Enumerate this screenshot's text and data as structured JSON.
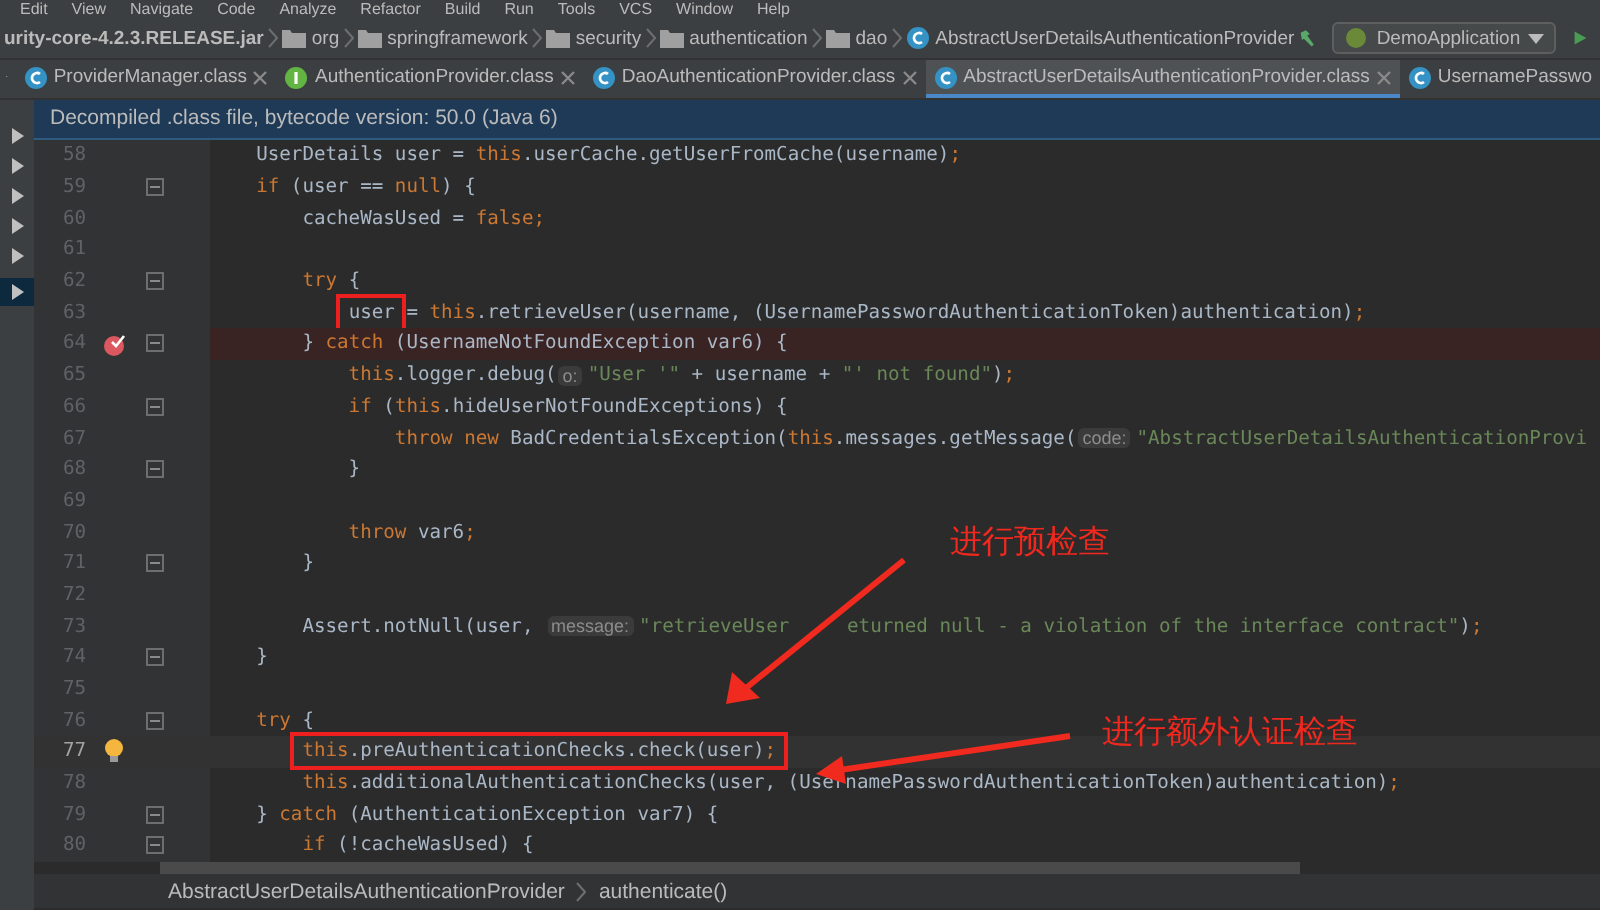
{
  "menu": [
    "Edit",
    "View",
    "Navigate",
    "Code",
    "Analyze",
    "Refactor",
    "Build",
    "Run",
    "Tools",
    "VCS",
    "Window",
    "Help"
  ],
  "breadcrumb": [
    {
      "label": "urity-core-4.2.3.RELEASE.jar",
      "kind": "jar"
    },
    {
      "label": "org",
      "kind": "package"
    },
    {
      "label": "springframework",
      "kind": "package"
    },
    {
      "label": "security",
      "kind": "package"
    },
    {
      "label": "authentication",
      "kind": "package"
    },
    {
      "label": "dao",
      "kind": "package"
    },
    {
      "label": "AbstractUserDetailsAuthenticationProvider",
      "kind": "class"
    }
  ],
  "run_config": "DemoApplication",
  "tabs": [
    {
      "label": "ProviderManager.class",
      "kind": "class",
      "selected": false,
      "closable": true
    },
    {
      "label": "AuthenticationProvider.class",
      "kind": "interface",
      "selected": false,
      "closable": true
    },
    {
      "label": "DaoAuthenticationProvider.class",
      "kind": "class",
      "selected": false,
      "closable": true
    },
    {
      "label": "AbstractUserDetailsAuthenticationProvider.class",
      "kind": "class",
      "selected": true,
      "closable": true
    },
    {
      "label": "UsernamePasswo",
      "kind": "class",
      "selected": false,
      "closable": false
    }
  ],
  "info_bar": "Decompiled .class file, bytecode version: 50.0 (Java 6)",
  "tree_rows": [
    {
      "selected": false
    },
    {
      "selected": false
    },
    {
      "selected": false
    },
    {
      "selected": false
    },
    {
      "selected": false
    },
    {
      "selected": true
    }
  ],
  "lines": [
    {
      "number": "58",
      "fold": false,
      "breakpoint": false,
      "current": false,
      "tokens": [
        {
          "kind": "plain",
          "text": "    UserDetails user = "
        },
        {
          "kind": "kw",
          "text": "this"
        },
        {
          "kind": "plain",
          "text": ".userCache.getUserFromCache(username)"
        },
        {
          "kind": "kw",
          "text": ";"
        }
      ]
    },
    {
      "number": "59",
      "fold": true,
      "breakpoint": false,
      "current": false,
      "tokens": [
        {
          "kind": "kw",
          "text": "    if"
        },
        {
          "kind": "plain",
          "text": " (user == "
        },
        {
          "kind": "kw",
          "text": "null"
        },
        {
          "kind": "plain",
          "text": ") {"
        }
      ]
    },
    {
      "number": "60",
      "fold": false,
      "breakpoint": false,
      "current": false,
      "tokens": [
        {
          "kind": "plain",
          "text": "        cacheWasUsed = "
        },
        {
          "kind": "kw",
          "text": "false;"
        }
      ]
    },
    {
      "number": "61",
      "fold": false,
      "breakpoint": false,
      "current": false
    },
    {
      "number": "62",
      "fold": true,
      "breakpoint": false,
      "current": false,
      "tokens": [
        {
          "kind": "kw",
          "text": "        try"
        },
        {
          "kind": "plain",
          "text": " {"
        }
      ]
    },
    {
      "number": "63",
      "fold": false,
      "breakpoint": false,
      "current": false,
      "tokens": [
        {
          "kind": "boxed",
          "tokens": [
            {
              "kind": "plain",
              "text": "user"
            }
          ]
        },
        {
          "kind": "plain",
          "text": " = "
        },
        {
          "kind": "kw",
          "text": "this"
        },
        {
          "kind": "plain",
          "text": ".retrieveUser(username, (UsernamePasswordAuthenticationToken)authentication)"
        },
        {
          "kind": "kw",
          "text": ";"
        }
      ]
    },
    {
      "number": "64",
      "fold": true,
      "breakpoint": true,
      "current": false,
      "tokens": [
        {
          "kind": "plain",
          "text": "        } "
        },
        {
          "kind": "kw",
          "text": "catch"
        },
        {
          "kind": "plain",
          "text": " (UsernameNotFoundException var6) {"
        }
      ]
    },
    {
      "number": "65",
      "fold": false,
      "breakpoint": false,
      "current": false,
      "tokens": [
        {
          "kind": "kw",
          "text": "            this"
        },
        {
          "kind": "plain",
          "text": ".logger.debug("
        },
        {
          "kind": "hint",
          "text": "o:"
        },
        {
          "kind": "str",
          "text": "\"User '\""
        },
        {
          "kind": "plain",
          "text": " + username + "
        },
        {
          "kind": "str",
          "text": "\"' not found\""
        },
        {
          "kind": "plain",
          "text": ")"
        },
        {
          "kind": "kw",
          "text": ";"
        }
      ]
    },
    {
      "number": "66",
      "fold": true,
      "breakpoint": false,
      "current": false,
      "tokens": [
        {
          "kind": "kw",
          "text": "            if"
        },
        {
          "kind": "plain",
          "text": " ("
        },
        {
          "kind": "kw",
          "text": "this"
        },
        {
          "kind": "plain",
          "text": ".hideUserNotFoundExceptions) {"
        }
      ]
    },
    {
      "number": "67",
      "fold": false,
      "breakpoint": false,
      "current": false,
      "tokens": [
        {
          "kind": "kw",
          "text": "                throw new"
        },
        {
          "kind": "plain",
          "text": " BadCredentialsException("
        },
        {
          "kind": "kw",
          "text": "this"
        },
        {
          "kind": "plain",
          "text": ".messages.getMessage("
        },
        {
          "kind": "hint",
          "text": "code:"
        },
        {
          "kind": "str",
          "text": "\"AbstractUserDetailsAuthenticationProvi"
        }
      ]
    },
    {
      "number": "68",
      "fold": true,
      "breakpoint": false,
      "current": false,
      "tokens": [
        {
          "kind": "plain",
          "text": "            }"
        }
      ]
    },
    {
      "number": "69",
      "fold": false,
      "breakpoint": false,
      "current": false
    },
    {
      "number": "70",
      "fold": false,
      "breakpoint": false,
      "current": false,
      "tokens": [
        {
          "kind": "kw",
          "text": "            throw"
        },
        {
          "kind": "plain",
          "text": " var6"
        },
        {
          "kind": "kw",
          "text": ";"
        }
      ]
    },
    {
      "number": "71",
      "fold": true,
      "breakpoint": false,
      "current": false,
      "tokens": [
        {
          "kind": "plain",
          "text": "        }"
        }
      ]
    },
    {
      "number": "72",
      "fold": false,
      "breakpoint": false,
      "current": false
    },
    {
      "number": "73",
      "fold": false,
      "breakpoint": false,
      "current": false,
      "tokens": [
        {
          "kind": "plain",
          "text": "        Assert.notNull(user, "
        },
        {
          "kind": "hint",
          "text": "message:"
        },
        {
          "kind": "str",
          "text": "\"retrieveUser"
        },
        {
          "kind": "str",
          "text": "     eturned null - a violation of the interface contract\""
        },
        {
          "kind": "plain",
          "text": ")"
        },
        {
          "kind": "kw",
          "text": ";"
        }
      ]
    },
    {
      "number": "74",
      "fold": true,
      "breakpoint": false,
      "current": false,
      "tokens": [
        {
          "kind": "plain",
          "text": "    }"
        }
      ]
    },
    {
      "number": "75",
      "fold": false,
      "breakpoint": false,
      "current": false
    },
    {
      "number": "76",
      "fold": true,
      "breakpoint": false,
      "current": false,
      "tokens": [
        {
          "kind": "kw",
          "text": "    try"
        },
        {
          "kind": "plain",
          "text": " {"
        }
      ]
    },
    {
      "number": "77",
      "fold": false,
      "breakpoint": false,
      "current": true,
      "tokens": [
        {
          "kind": "boxed",
          "tokens": [
            {
              "kind": "kw",
              "text": "this"
            },
            {
              "kind": "plain",
              "text": ".preAuthenticationChecks.check(user)"
            },
            {
              "kind": "kw",
              "text": ";"
            }
          ]
        }
      ]
    },
    {
      "number": "78",
      "fold": false,
      "breakpoint": false,
      "current": false,
      "tokens": [
        {
          "kind": "kw",
          "text": "        this"
        },
        {
          "kind": "plain",
          "text": ".additionalAuthenticationChecks(user, (UsernamePasswordAuthenticationToken)authentication)"
        },
        {
          "kind": "kw",
          "text": ";"
        }
      ]
    },
    {
      "number": "79",
      "fold": true,
      "breakpoint": false,
      "current": false,
      "tokens": [
        {
          "kind": "plain",
          "text": "    } "
        },
        {
          "kind": "kw",
          "text": "catch"
        },
        {
          "kind": "plain",
          "text": " (AuthenticationException var7) {"
        }
      ]
    },
    {
      "number": "80",
      "fold": true,
      "breakpoint": false,
      "current": false,
      "tokens": [
        {
          "kind": "kw",
          "text": "        if"
        },
        {
          "kind": "plain",
          "text": " (!cacheWasUsed) {"
        }
      ]
    }
  ],
  "annotations": [
    {
      "text": "进行预检查"
    },
    {
      "text": "进行额外认证检查"
    }
  ],
  "status_breadcrumb": [
    "AbstractUserDetailsAuthenticationProvider",
    "authenticate()"
  ]
}
